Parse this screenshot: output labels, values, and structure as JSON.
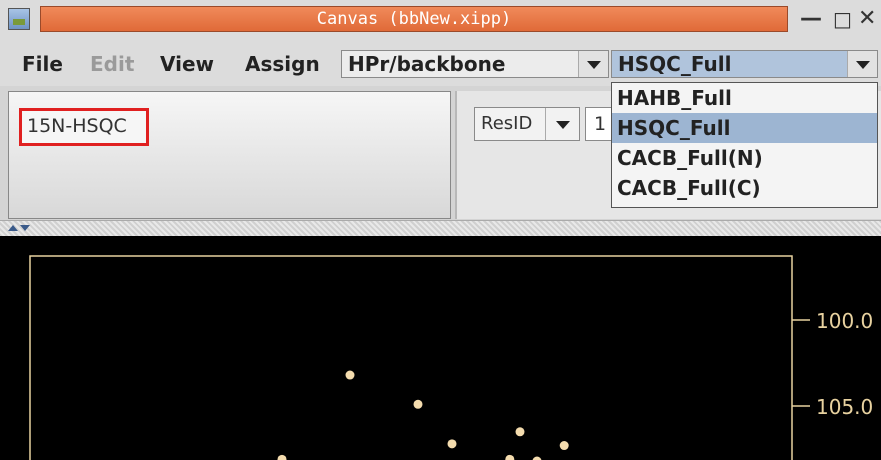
{
  "window": {
    "title": "Canvas (bbNew.xipp)",
    "minimize_glyph": "—",
    "maximize_glyph": "□",
    "close_glyph": "✕"
  },
  "menu": {
    "file": "File",
    "edit": "Edit",
    "view": "View",
    "assign": "Assign"
  },
  "combos": {
    "molecule": "HPr/backbone",
    "experiment": "HSQC_Full"
  },
  "dropdown": {
    "items": [
      "HAHB_Full",
      "HSQC_Full",
      "CACB_Full(N)",
      "CACB_Full(C)"
    ],
    "selected_index": 1
  },
  "left_panel": {
    "spectrum_label": "15N-HSQC"
  },
  "right_panel": {
    "resid_label": "ResID",
    "resid_value": "1"
  },
  "spectrum": {
    "axis_ticks": [
      "100.0",
      "105.0"
    ],
    "peak_color": "#f4dcae",
    "frame_color": "#e8d2a0",
    "peaks": [
      {
        "h": 8.25,
        "n": 103.2
      },
      {
        "h": 7.75,
        "n": 106.5
      },
      {
        "h": 7.95,
        "n": 107.2
      },
      {
        "h": 7.78,
        "n": 108.1
      },
      {
        "h": 7.7,
        "n": 108.2
      },
      {
        "h": 7.62,
        "n": 107.3
      },
      {
        "h": 8.45,
        "n": 108.1
      },
      {
        "h": 7.4,
        "n": 108.4
      },
      {
        "h": 8.05,
        "n": 104.9
      }
    ]
  }
}
